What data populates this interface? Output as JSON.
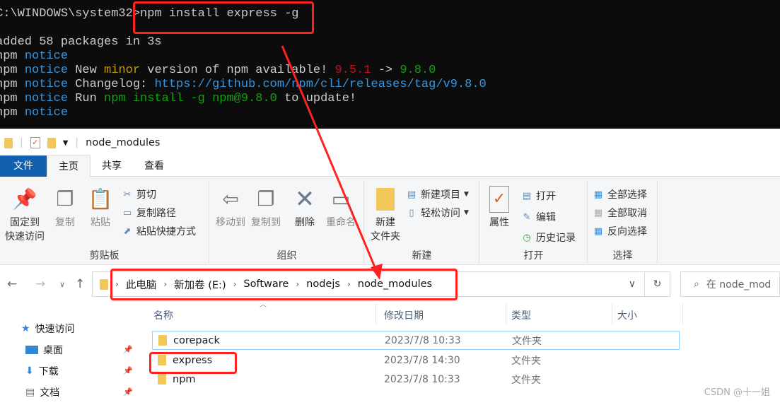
{
  "terminal": {
    "prompt": "C:\\WINDOWS\\system32>",
    "command": "npm install express -g",
    "added": "added 58 packages in 3s",
    "npm": "npm",
    "notice": "notice",
    "l2": {
      "a": "New ",
      "minor": "minor",
      "b": " version of npm available! ",
      "old": "9.5.1",
      "arrow": " -> ",
      "new": "9.8.0"
    },
    "l3": {
      "a": "Changelog: ",
      "url": "https://github.com/npm/cli/releases/tag/v9.8.0"
    },
    "l4": {
      "a": "Run ",
      "cmd": "npm install -g npm@9.8.0",
      "b": " to update!"
    }
  },
  "window": {
    "title": "node_modules"
  },
  "tabs": [
    "文件",
    "主页",
    "共享",
    "查看"
  ],
  "ribbon": {
    "clipboard": {
      "label": "剪贴板",
      "pin1": "固定到",
      "pin2": "快速访问",
      "copy": "复制",
      "paste": "粘贴",
      "cut": "剪切",
      "copy_path": "复制路径",
      "paste_shortcut": "粘贴快捷方式"
    },
    "organize": {
      "label": "组织",
      "move_to": "移动到",
      "copy_to": "复制到",
      "delete": "删除",
      "rename": "重命名"
    },
    "new": {
      "label": "新建",
      "new_folder1": "新建",
      "new_folder2": "文件夹",
      "new_item": "新建项目",
      "easy_access": "轻松访问"
    },
    "open": {
      "label": "打开",
      "properties": "属性",
      "open": "打开",
      "edit": "编辑",
      "history": "历史记录"
    },
    "select": {
      "label": "选择",
      "select_all": "全部选择",
      "select_none": "全部取消",
      "invert": "反向选择"
    }
  },
  "address": {
    "crumbs": [
      "此电脑",
      "新加卷 (E:)",
      "Software",
      "nodejs",
      "node_modules"
    ],
    "search_placeholder": "在 node_mod"
  },
  "nav": [
    {
      "label": "快速访问"
    },
    {
      "label": "桌面"
    },
    {
      "label": "下载"
    },
    {
      "label": "文档"
    }
  ],
  "columns": [
    "名称",
    "修改日期",
    "类型",
    "大小"
  ],
  "files": [
    {
      "name": "corepack",
      "date": "2023/7/8 10:33",
      "type": "文件夹"
    },
    {
      "name": "express",
      "date": "2023/7/8 14:30",
      "type": "文件夹"
    },
    {
      "name": "npm",
      "date": "2023/7/8 10:33",
      "type": "文件夹"
    }
  ],
  "watermark": "CSDN @十一姐",
  "colors": {
    "annotation": "#ff2020",
    "file_tab": "#1160b0"
  }
}
